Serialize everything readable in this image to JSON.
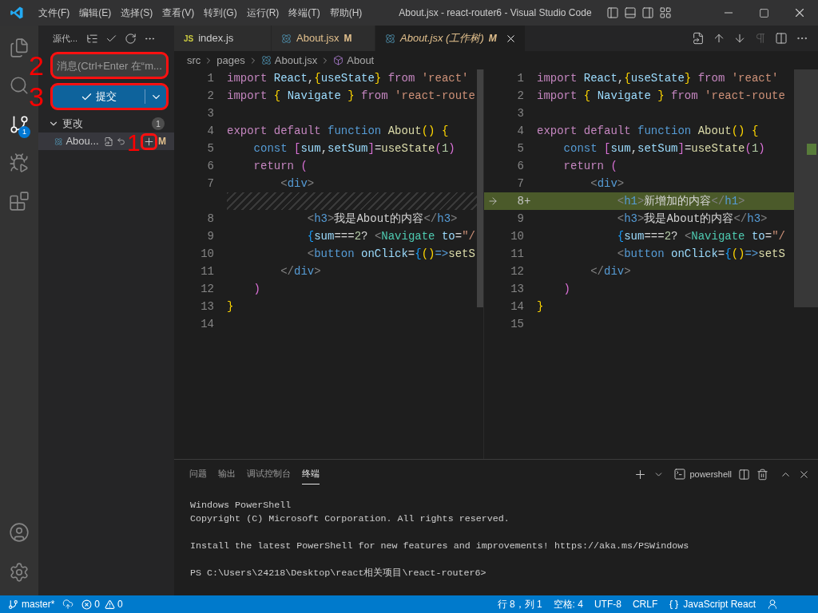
{
  "title_bar": {
    "menus": [
      "文件(F)",
      "编辑(E)",
      "选择(S)",
      "查看(V)",
      "转到(G)",
      "运行(R)",
      "终端(T)",
      "帮助(H)"
    ],
    "title": "About.jsx - react-router6 - Visual Studio Code"
  },
  "activity_bar": {
    "source_control_badge": "1"
  },
  "sidebar": {
    "title": "源代...",
    "message_field": {
      "placeholder": "消息(Ctrl+Enter 在“m...",
      "annotation": "2"
    },
    "commit_button": {
      "label": "提交",
      "annotation": "3"
    },
    "changes": {
      "label": "更改",
      "expanded": true,
      "count": "1"
    },
    "files": [
      {
        "name": "Abou...",
        "status": "M",
        "stage_annotation": "1",
        "selected": true
      }
    ]
  },
  "tabs": [
    {
      "badge": "JS",
      "label": "index.js",
      "selected": false,
      "preview": false
    },
    {
      "label": "About.jsx",
      "status": "M",
      "selected": false,
      "preview": false
    },
    {
      "label": "About.jsx (工作树)",
      "status": "M",
      "selected": true,
      "preview": true
    }
  ],
  "breadcrumbs": [
    "src",
    "pages",
    "About.jsx",
    "About"
  ],
  "left_pane": [
    {
      "kind": "code",
      "number": "1",
      "tokens": [
        {
          "kind": "kw",
          "text": "import "
        },
        {
          "kind": "var",
          "text": "React"
        },
        {
          "kind": "plain",
          "text": ","
        },
        {
          "kind": "b1",
          "text": "{"
        },
        {
          "kind": "var",
          "text": "useState"
        },
        {
          "kind": "b1",
          "text": "} "
        },
        {
          "kind": "kw",
          "text": "from "
        },
        {
          "kind": "str",
          "text": "'react'"
        }
      ]
    },
    {
      "kind": "code",
      "number": "2",
      "tokens": [
        {
          "kind": "kw",
          "text": "import "
        },
        {
          "kind": "b1",
          "text": "{ "
        },
        {
          "kind": "var",
          "text": "Navigate "
        },
        {
          "kind": "b1",
          "text": "} "
        },
        {
          "kind": "kw",
          "text": "from "
        },
        {
          "kind": "str",
          "text": "'react-route"
        }
      ]
    },
    {
      "kind": "code",
      "number": "3"
    },
    {
      "kind": "code",
      "number": "4",
      "tokens": [
        {
          "kind": "kw",
          "text": "export default "
        },
        {
          "kind": "storage",
          "text": "function "
        },
        {
          "kind": "fn",
          "text": "About"
        },
        {
          "kind": "b1",
          "text": "() {"
        }
      ]
    },
    {
      "kind": "code",
      "number": "5",
      "tokens": [
        {
          "kind": "storage",
          "text": "    const "
        },
        {
          "kind": "b2",
          "text": "["
        },
        {
          "kind": "var",
          "text": "sum"
        },
        {
          "kind": "plain",
          "text": ","
        },
        {
          "kind": "var",
          "text": "setSum"
        },
        {
          "kind": "b2",
          "text": "]"
        },
        {
          "kind": "plain",
          "text": "="
        },
        {
          "kind": "fn",
          "text": "useState"
        },
        {
          "kind": "b2",
          "text": "("
        },
        {
          "kind": "num",
          "text": "1"
        },
        {
          "kind": "b2",
          "text": ")"
        }
      ]
    },
    {
      "kind": "code",
      "number": "6",
      "tokens": [
        {
          "kind": "kw",
          "text": "    return "
        },
        {
          "kind": "b2",
          "text": "("
        }
      ]
    },
    {
      "kind": "code",
      "number": "7",
      "tokens": [
        {
          "kind": "punct",
          "text": "        <"
        },
        {
          "kind": "tag",
          "text": "div"
        },
        {
          "kind": "punct",
          "text": ">"
        }
      ]
    },
    {
      "kind": "filler"
    },
    {
      "kind": "code",
      "number": "8",
      "tokens": [
        {
          "kind": "punct",
          "text": "            <"
        },
        {
          "kind": "tag",
          "text": "h3"
        },
        {
          "kind": "punct",
          "text": ">"
        },
        {
          "kind": "plain",
          "text": "我是About的内容"
        },
        {
          "kind": "punct",
          "text": "</"
        },
        {
          "kind": "tag",
          "text": "h3"
        },
        {
          "kind": "punct",
          "text": ">"
        }
      ]
    },
    {
      "kind": "code",
      "number": "9",
      "tokens": [
        {
          "kind": "b3",
          "text": "            {"
        },
        {
          "kind": "var",
          "text": "sum"
        },
        {
          "kind": "plain",
          "text": "==="
        },
        {
          "kind": "num",
          "text": "2"
        },
        {
          "kind": "plain",
          "text": "? "
        },
        {
          "kind": "punct",
          "text": "<"
        },
        {
          "kind": "comp",
          "text": "Navigate "
        },
        {
          "kind": "var",
          "text": "to"
        },
        {
          "kind": "plain",
          "text": "="
        },
        {
          "kind": "str",
          "text": "\"/"
        }
      ]
    },
    {
      "kind": "code",
      "number": "10",
      "tokens": [
        {
          "kind": "punct",
          "text": "            <"
        },
        {
          "kind": "tag",
          "text": "button "
        },
        {
          "kind": "var",
          "text": "onClick"
        },
        {
          "kind": "plain",
          "text": "="
        },
        {
          "kind": "b3",
          "text": "{"
        },
        {
          "kind": "b1",
          "text": "()"
        },
        {
          "kind": "storage",
          "text": "=>"
        },
        {
          "kind": "fn",
          "text": "setS"
        }
      ]
    },
    {
      "kind": "code",
      "number": "11",
      "tokens": [
        {
          "kind": "punct",
          "text": "        </"
        },
        {
          "kind": "tag",
          "text": "div"
        },
        {
          "kind": "punct",
          "text": ">"
        }
      ]
    },
    {
      "kind": "code",
      "number": "12",
      "tokens": [
        {
          "kind": "b2",
          "text": "    )"
        }
      ]
    },
    {
      "kind": "code",
      "number": "13",
      "tokens": [
        {
          "kind": "b1",
          "text": "}"
        }
      ]
    },
    {
      "kind": "code",
      "number": "14"
    }
  ],
  "right_pane": [
    {
      "kind": "code",
      "number": "1",
      "tokens": [
        {
          "kind": "kw",
          "text": "import "
        },
        {
          "kind": "var",
          "text": "React"
        },
        {
          "kind": "plain",
          "text": ","
        },
        {
          "kind": "b1",
          "text": "{"
        },
        {
          "kind": "var",
          "text": "useState"
        },
        {
          "kind": "b1",
          "text": "} "
        },
        {
          "kind": "kw",
          "text": "from "
        },
        {
          "kind": "str",
          "text": "'react'"
        }
      ]
    },
    {
      "kind": "code",
      "number": "2",
      "tokens": [
        {
          "kind": "kw",
          "text": "import "
        },
        {
          "kind": "b1",
          "text": "{ "
        },
        {
          "kind": "var",
          "text": "Navigate "
        },
        {
          "kind": "b1",
          "text": "} "
        },
        {
          "kind": "kw",
          "text": "from "
        },
        {
          "kind": "str",
          "text": "'react-route"
        }
      ]
    },
    {
      "kind": "code",
      "number": "3"
    },
    {
      "kind": "code",
      "number": "4",
      "tokens": [
        {
          "kind": "kw",
          "text": "export default "
        },
        {
          "kind": "storage",
          "text": "function "
        },
        {
          "kind": "fn",
          "text": "About"
        },
        {
          "kind": "b1",
          "text": "() {"
        }
      ]
    },
    {
      "kind": "code",
      "number": "5",
      "tokens": [
        {
          "kind": "storage",
          "text": "    const "
        },
        {
          "kind": "b2",
          "text": "["
        },
        {
          "kind": "var",
          "text": "sum"
        },
        {
          "kind": "plain",
          "text": ","
        },
        {
          "kind": "var",
          "text": "setSum"
        },
        {
          "kind": "b2",
          "text": "]"
        },
        {
          "kind": "plain",
          "text": "="
        },
        {
          "kind": "fn",
          "text": "useState"
        },
        {
          "kind": "b2",
          "text": "("
        },
        {
          "kind": "num",
          "text": "1"
        },
        {
          "kind": "b2",
          "text": ")"
        }
      ]
    },
    {
      "kind": "code",
      "number": "6",
      "tokens": [
        {
          "kind": "kw",
          "text": "    return "
        },
        {
          "kind": "b2",
          "text": "("
        }
      ]
    },
    {
      "kind": "code",
      "number": "7",
      "tokens": [
        {
          "kind": "punct",
          "text": "        <"
        },
        {
          "kind": "tag",
          "text": "div"
        },
        {
          "kind": "punct",
          "text": ">"
        }
      ]
    },
    {
      "kind": "added",
      "number": "8",
      "marker": "+",
      "tokens": [
        {
          "kind": "punct",
          "text": "            <"
        },
        {
          "kind": "tag",
          "text": "h1"
        },
        {
          "kind": "punct",
          "text": ">"
        },
        {
          "kind": "plain",
          "text": "新增加的内容"
        },
        {
          "kind": "punct",
          "text": "</"
        },
        {
          "kind": "tag",
          "text": "h1"
        },
        {
          "kind": "punct",
          "text": ">"
        }
      ]
    },
    {
      "kind": "code",
      "number": "9",
      "tokens": [
        {
          "kind": "punct",
          "text": "            <"
        },
        {
          "kind": "tag",
          "text": "h3"
        },
        {
          "kind": "punct",
          "text": ">"
        },
        {
          "kind": "plain",
          "text": "我是About的内容"
        },
        {
          "kind": "punct",
          "text": "</"
        },
        {
          "kind": "tag",
          "text": "h3"
        },
        {
          "kind": "punct",
          "text": ">"
        }
      ]
    },
    {
      "kind": "code",
      "number": "10",
      "tokens": [
        {
          "kind": "b3",
          "text": "            {"
        },
        {
          "kind": "var",
          "text": "sum"
        },
        {
          "kind": "plain",
          "text": "==="
        },
        {
          "kind": "num",
          "text": "2"
        },
        {
          "kind": "plain",
          "text": "? "
        },
        {
          "kind": "punct",
          "text": "<"
        },
        {
          "kind": "comp",
          "text": "Navigate "
        },
        {
          "kind": "var",
          "text": "to"
        },
        {
          "kind": "plain",
          "text": "="
        },
        {
          "kind": "str",
          "text": "\"/"
        }
      ]
    },
    {
      "kind": "code",
      "number": "11",
      "tokens": [
        {
          "kind": "punct",
          "text": "            <"
        },
        {
          "kind": "tag",
          "text": "button "
        },
        {
          "kind": "var",
          "text": "onClick"
        },
        {
          "kind": "plain",
          "text": "="
        },
        {
          "kind": "b3",
          "text": "{"
        },
        {
          "kind": "b1",
          "text": "()"
        },
        {
          "kind": "storage",
          "text": "=>"
        },
        {
          "kind": "fn",
          "text": "setS"
        }
      ]
    },
    {
      "kind": "code",
      "number": "12",
      "tokens": [
        {
          "kind": "punct",
          "text": "        </"
        },
        {
          "kind": "tag",
          "text": "div"
        },
        {
          "kind": "punct",
          "text": ">"
        }
      ]
    },
    {
      "kind": "code",
      "number": "13",
      "tokens": [
        {
          "kind": "b2",
          "text": "    )"
        }
      ]
    },
    {
      "kind": "code",
      "number": "14",
      "tokens": [
        {
          "kind": "b1",
          "text": "}"
        }
      ]
    },
    {
      "kind": "code",
      "number": "15"
    }
  ],
  "panel": {
    "tabs": [
      {
        "label": "问题",
        "selected": false
      },
      {
        "label": "输出",
        "selected": false
      },
      {
        "label": "调试控制台",
        "selected": false
      },
      {
        "label": "终端",
        "selected": true
      }
    ],
    "terminal_name": "powershell",
    "paragraphs": [
      [
        "Windows PowerShell",
        "Copyright (C) Microsoft Corporation. All rights reserved."
      ],
      [
        "Install the latest PowerShell for new features and improvements! https://aka.ms/PSWindows"
      ],
      [
        "PS C:\\Users\\24218\\Desktop\\react相关项目\\react-router6>"
      ]
    ]
  },
  "status_bar": {
    "branch": "master*",
    "errors": "0",
    "warnings": "0",
    "position": "行 8，列 1",
    "indent": "空格: 4",
    "encoding": "UTF-8",
    "eol": "CRLF",
    "language": "JavaScript React"
  }
}
